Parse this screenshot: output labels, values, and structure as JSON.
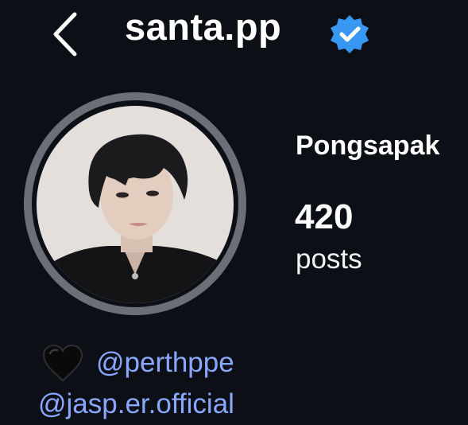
{
  "header": {
    "username": "santa.pp",
    "verified": true,
    "back_icon": "chevron-left-icon",
    "verified_icon": "verified-badge-icon"
  },
  "profile": {
    "display_name": "Pongsapak",
    "posts_count": "420",
    "posts_label": "posts"
  },
  "bio": {
    "emoji": "black-heart",
    "links": [
      "@perthppe",
      "@jasp.er.official"
    ]
  },
  "colors": {
    "background": "#0c0f16",
    "text": "#ffffff",
    "link": "#8aa7ff",
    "verified": "#3897f0",
    "avatar_ring": "#6c6f77"
  }
}
